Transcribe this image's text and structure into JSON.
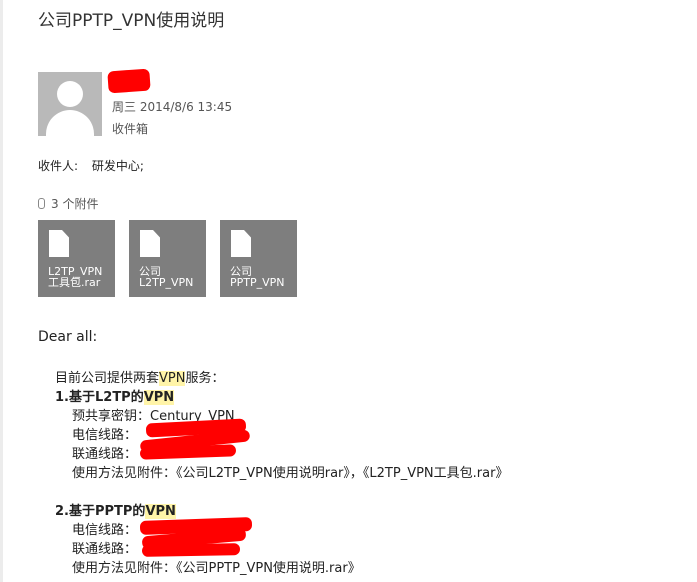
{
  "email": {
    "subject": "公司PPTP_VPN使用说明",
    "date": "周三 2014/8/6 13:45",
    "folder": "收件箱",
    "to_label": "收件人:",
    "to_value": "研发中心;"
  },
  "attachments": {
    "count_label": "3 个附件",
    "items": [
      {
        "line1": "L2TP_VPN",
        "line2": "工具包.rar"
      },
      {
        "line1": "公司",
        "line2": "L2TP_VPN"
      },
      {
        "line1": "公司",
        "line2": "PPTP_VPN"
      }
    ]
  },
  "body": {
    "greeting": "Dear all:",
    "intro_a": "目前公司提供两套",
    "intro_vpn": "VPN",
    "intro_b": "服务：",
    "s1_title_a": "1.基于L2TP的",
    "s1_title_vpn": "VPN",
    "s1_psk": "预共享密钥：Century_VPN",
    "s1_telecom": "电信线路：",
    "s1_unicom": "联通线路：",
    "s1_usage": "使用方法见附件：《公司L2TP_VPN使用说明rar》，《L2TP_VPN工具包.rar》",
    "s2_title_a": "2.基于PPTP的",
    "s2_title_vpn": "VPN",
    "s2_telecom": "电信线路：",
    "s2_unicom": "联通线路：",
    "s2_usage": "使用方法见附件：《公司PPTP_VPN使用说明.rar》"
  },
  "colors": {
    "redaction": "#ff0000",
    "highlight": "#fff4a8",
    "attachment_tile": "#7e7e7e",
    "avatar": "#b9b9b9"
  },
  "icons": [
    "person-avatar-icon",
    "paperclip-icon",
    "document-icon"
  ]
}
